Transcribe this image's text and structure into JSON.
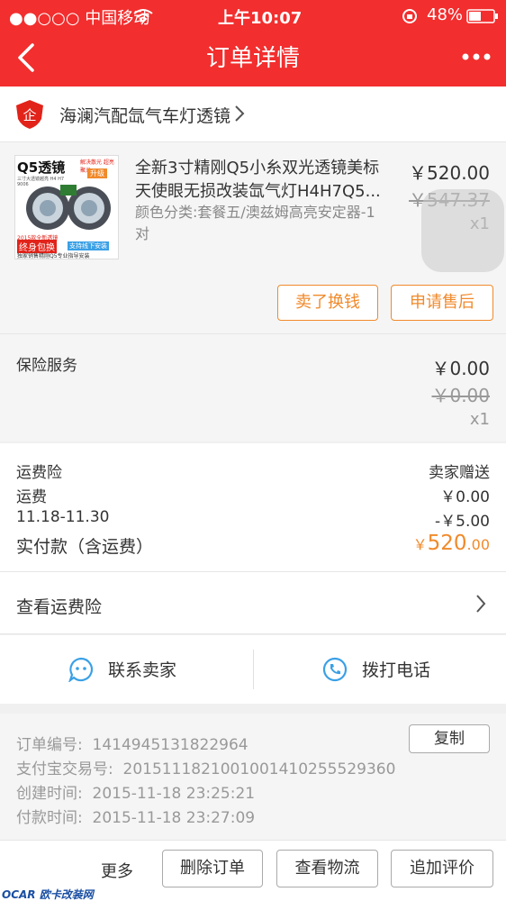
{
  "status_bar": {
    "carrier": "●●○○○ 中国移动",
    "time": "上午10:07",
    "battery": "48%"
  },
  "nav": {
    "title": "订单详情",
    "back_icon": "back-chevron-icon",
    "more_icon": "more-dots-icon"
  },
  "shop": {
    "name": "海澜汽配氙气车灯透镜"
  },
  "product": {
    "title": "全新3寸精刚Q5小糸双光透镜美标天使眼无损改装氙气灯H4H7Q5...",
    "spec": "颜色分类:套餐五/澳兹姆高亮安定器-1对",
    "price": "￥520.00",
    "original_price": "￥547.37",
    "qty": "x1",
    "thumb": {
      "brand": "Q5透镜",
      "tag1": "解决散光 超亮聚光",
      "tag2": "升级",
      "sub": "三寸大透镜越亮 H4 H7 9006",
      "badge1": "终身包换",
      "badge2": "支持线下安装",
      "year": "2015款全新透镜",
      "bottom": "独家销售精刚Q5专业指导安装"
    },
    "btn_sell": "卖了换钱",
    "btn_after_sale": "申请售后"
  },
  "insurance": {
    "label": "保险服务",
    "price": "￥0.00",
    "original_price": "￥0.00",
    "qty": "x1"
  },
  "fees": [
    {
      "label": "运费险",
      "value": "卖家赠送"
    },
    {
      "label": "运费",
      "value": "￥0.00"
    },
    {
      "label": "11.18-11.30",
      "value": "-￥5.00"
    }
  ],
  "total": {
    "label": "实付款（含运费）",
    "currency": "￥",
    "amount": "520",
    "decimals": ".00"
  },
  "view_insurance": "查看运费险",
  "contact": {
    "seller": "联系卖家",
    "call": "拨打电话"
  },
  "order_info": {
    "order_no_label": "订单编号:",
    "order_no": "1414945131822964",
    "copy_btn": "复制",
    "alipay_label": "支付宝交易号:",
    "alipay_no": "2015111821001001410255529360",
    "created_label": "创建时间:",
    "created": "2015-11-18 23:25:21",
    "paid_label": "付款时间:",
    "paid": "2015-11-18 23:27:09"
  },
  "bottom_bar": {
    "more": "更多",
    "delete": "删除订单",
    "logistics": "查看物流",
    "review": "追加评价"
  },
  "watermark": "OCAR 欧卡改装网",
  "colors": {
    "brand_red": "#f22e2e",
    "orange": "#f08a2b",
    "blue_icon": "#3aa0e6"
  }
}
